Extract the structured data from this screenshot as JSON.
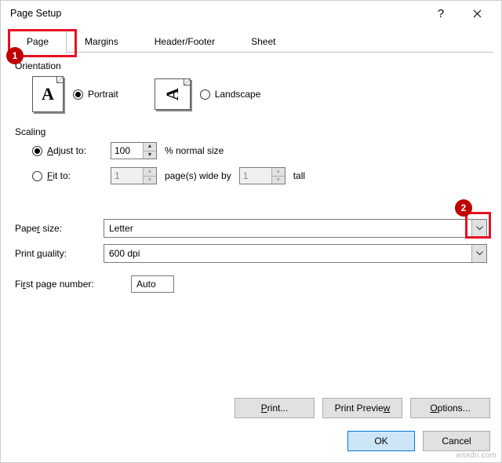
{
  "title": "Page Setup",
  "tabs": [
    "Page",
    "Margins",
    "Header/Footer",
    "Sheet"
  ],
  "active_tab": 0,
  "callouts": {
    "tab": "1",
    "dropdown": "2"
  },
  "orientation": {
    "label": "Orientation",
    "portrait": "Portrait",
    "landscape": "Landscape",
    "selected": "portrait"
  },
  "scaling": {
    "label": "Scaling",
    "adjust_label": "Adjust to:",
    "adjust_value": "100",
    "adjust_suffix": "% normal size",
    "fit_label": "Fit to:",
    "fit_wide": "1",
    "fit_mid": "page(s) wide by",
    "fit_tall": "1",
    "fit_suffix": "tall",
    "selected": "adjust"
  },
  "paper": {
    "label": "Paper size:",
    "value": "Letter"
  },
  "quality": {
    "label": "Print quality:",
    "value": "600 dpi"
  },
  "firstpage": {
    "label": "First page number:",
    "value": "Auto"
  },
  "buttons": {
    "print": "Print...",
    "preview": "Print Preview",
    "options": "Options...",
    "ok": "OK",
    "cancel": "Cancel"
  },
  "watermark": "wsxdn.com"
}
